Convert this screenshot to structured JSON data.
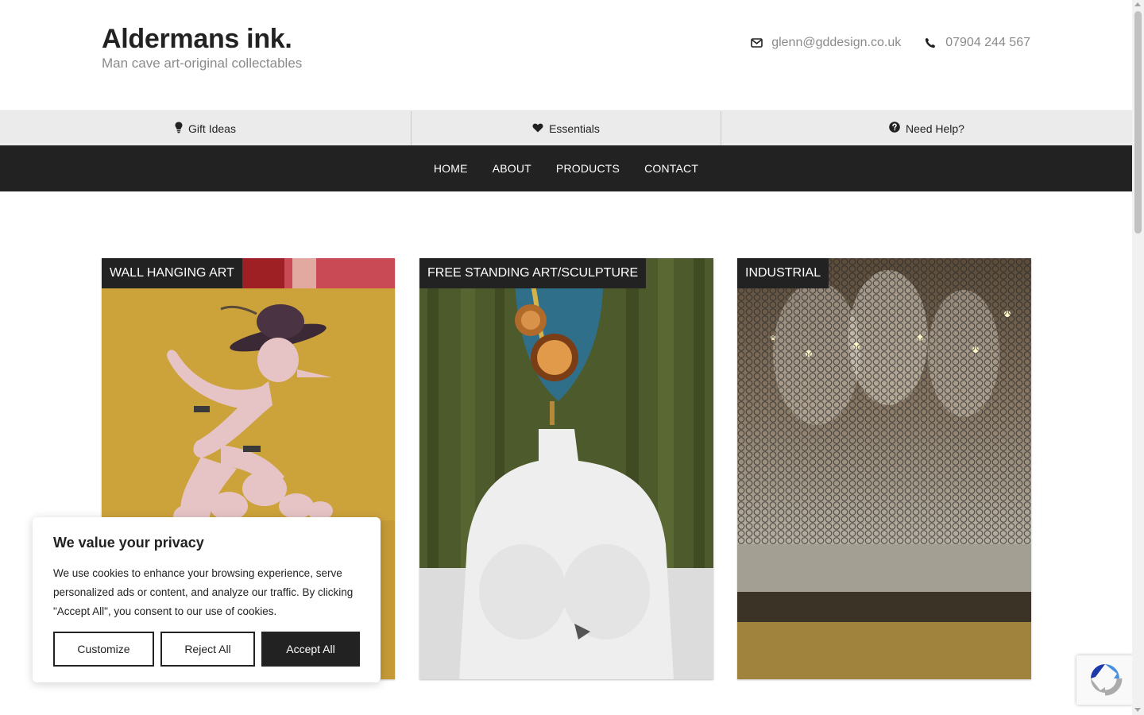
{
  "header": {
    "title": "Aldermans ink.",
    "tagline": "Man cave art-original collectables",
    "email": "glenn@gddesign.co.uk",
    "phone": "07904 244 567"
  },
  "topbar": {
    "items": [
      {
        "label": "Gift Ideas",
        "icon": "lightbulb-icon"
      },
      {
        "label": "Essentials",
        "icon": "heart-icon"
      },
      {
        "label": "Need Help?",
        "icon": "question-circle-icon"
      }
    ]
  },
  "nav": {
    "items": [
      "HOME",
      "ABOUT",
      "PRODUCTS",
      "CONTACT"
    ]
  },
  "categories": [
    {
      "label": "WALL HANGING ART"
    },
    {
      "label": "FREE STANDING ART/SCULPTURE"
    },
    {
      "label": "INDUSTRIAL"
    }
  ],
  "cookie": {
    "title": "We value your privacy",
    "text": "We use cookies to enhance your browsing experience, serve personalized ads or content, and analyze our traffic. By clicking \"Accept All\", you consent to our use of cookies.",
    "customize": "Customize",
    "reject": "Reject All",
    "accept": "Accept All"
  },
  "colors": {
    "dark": "#222222",
    "topbar": "#ebebeb",
    "muted_text": "#8a8a8a"
  }
}
